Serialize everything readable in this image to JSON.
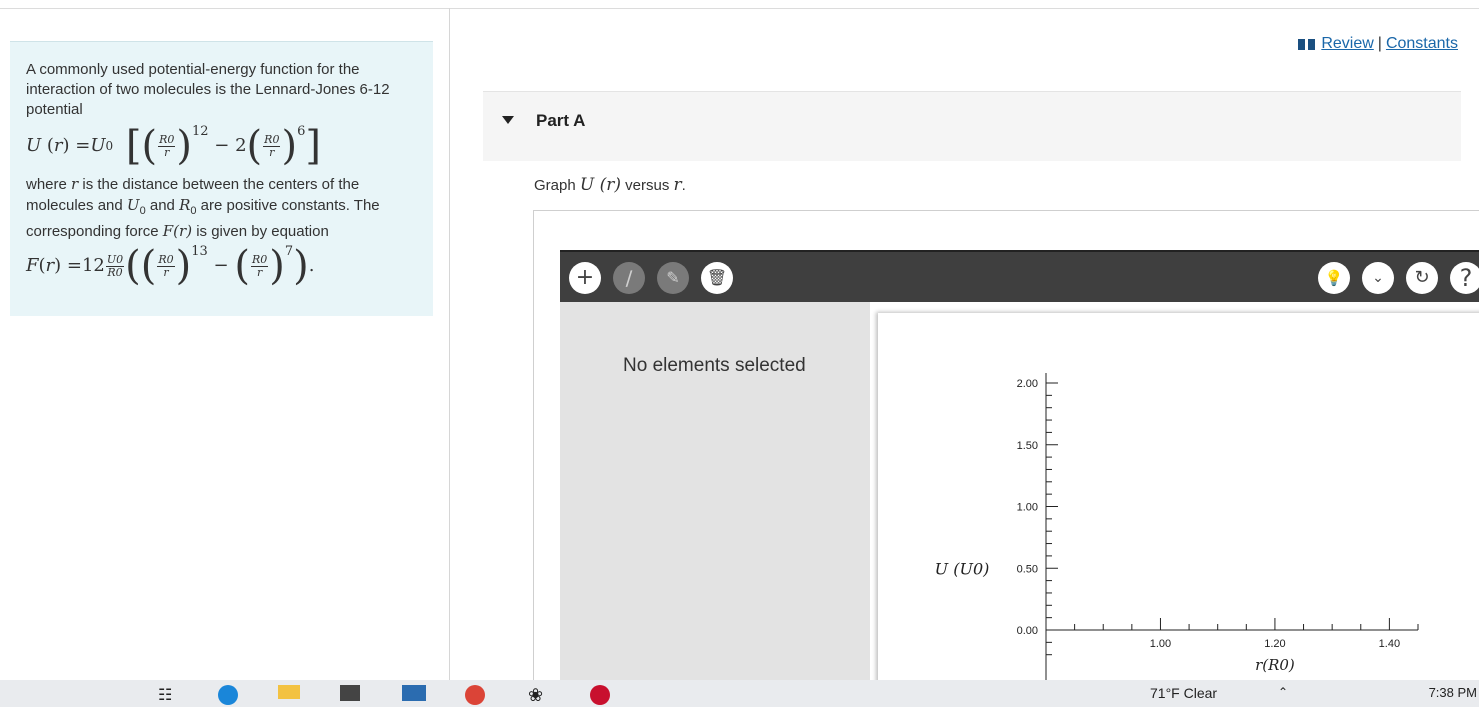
{
  "problem": {
    "intro": "A commonly used potential-energy function for the interaction of two molecules is the Lennard-Jones 6-12 potential",
    "where_1": "where ",
    "var_r": "r",
    "where_2": " is the distance between the centers of the molecules and ",
    "var_U0": "U",
    "sub0": "0",
    "and_text": " and ",
    "var_R0": "R",
    "where_3": " are positive constants. The corresponding force ",
    "var_F": "F",
    "paren_r": "(r)",
    "where_4": " is given by equation",
    "exp12": "12",
    "exp6": "6",
    "exp13": "13",
    "exp7": "7",
    "coef2": "2",
    "coef12": "12"
  },
  "links": {
    "review": "Review",
    "separator": "|",
    "constants": "Constants"
  },
  "part": {
    "label": "Part A"
  },
  "prompt": {
    "text_before": "Graph ",
    "func": "U (r)",
    "text_mid": " versus ",
    "var": "r",
    "text_end": "."
  },
  "toolbar": {
    "tools": [
      "add-point-icon",
      "no-line-icon",
      "add-label-icon",
      "trash-icon"
    ],
    "right_tools": [
      "hint-bulb-icon",
      "chevron-down-icon",
      "reset-icon",
      "help-icon"
    ],
    "help_glyph": "?"
  },
  "panel": {
    "message": "No elements selected"
  },
  "chart_data": {
    "type": "scatter",
    "x": [],
    "y": [],
    "xlabel": "r(R0)",
    "ylabel": "U (U0)",
    "xlim": [
      0.8,
      1.45
    ],
    "ylim": [
      0,
      2.0
    ],
    "x_tick_labels": [
      "1.00",
      "1.20",
      "1.40"
    ],
    "y_tick_labels": [
      "0.00",
      "0.50",
      "1.00",
      "1.50",
      "2.00"
    ],
    "grid": false
  },
  "taskbar": {
    "weather": "71°F  Clear",
    "time": "7:38 PM"
  },
  "colors": {
    "accent_link": "#1a67a9",
    "problem_bg": "#e8f5f8",
    "toolbar_bg": "#3f3f3f"
  }
}
